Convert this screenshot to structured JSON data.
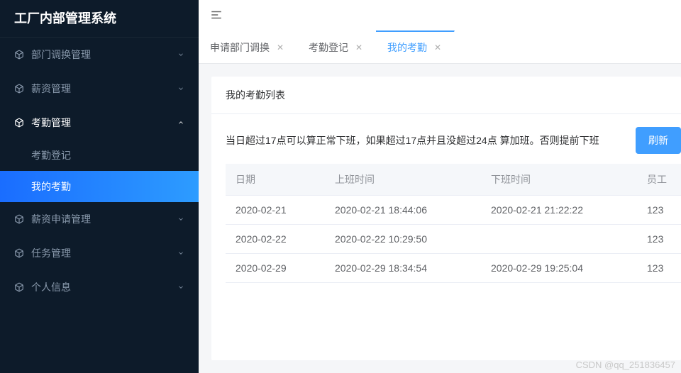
{
  "app_title": "工厂内部管理系统",
  "sidebar": {
    "items": [
      {
        "label": "部门调换管理",
        "expanded": false
      },
      {
        "label": "薪资管理",
        "expanded": false
      },
      {
        "label": "考勤管理",
        "expanded": true,
        "children": [
          {
            "label": "考勤登记",
            "active": false
          },
          {
            "label": "我的考勤",
            "active": true
          }
        ]
      },
      {
        "label": "薪资申请管理",
        "expanded": false
      },
      {
        "label": "任务管理",
        "expanded": false
      },
      {
        "label": "个人信息",
        "expanded": false
      }
    ]
  },
  "tabs": [
    {
      "label": "申请部门调换",
      "active": false
    },
    {
      "label": "考勤登记",
      "active": false
    },
    {
      "label": "我的考勤",
      "active": true
    }
  ],
  "panel": {
    "title": "我的考勤列表",
    "hint": "当日超过17点可以算正常下班，如果超过17点并且没超过24点 算加班。否则提前下班",
    "refresh_label": "刷新"
  },
  "table": {
    "columns": [
      "日期",
      "上班时间",
      "下班时间",
      "员工"
    ],
    "rows": [
      {
        "c0": "2020-02-21",
        "c1": "2020-02-21 18:44:06",
        "c2": "2020-02-21 21:22:22",
        "c3": "123"
      },
      {
        "c0": "2020-02-22",
        "c1": "2020-02-22 10:29:50",
        "c2": "",
        "c3": "123"
      },
      {
        "c0": "2020-02-29",
        "c1": "2020-02-29 18:34:54",
        "c2": "2020-02-29 19:25:04",
        "c3": "123"
      }
    ]
  },
  "watermark": "CSDN @qq_251836457"
}
